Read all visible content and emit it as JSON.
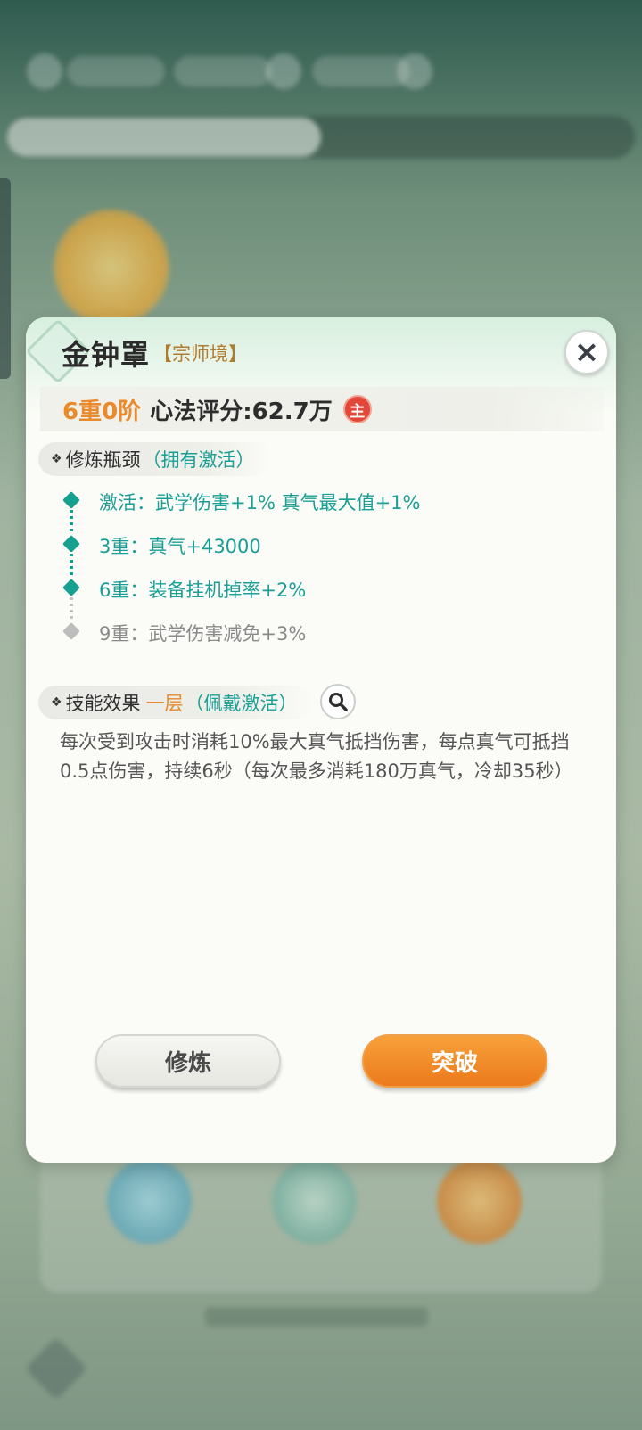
{
  "dialog": {
    "title": "金钟罩",
    "title_tag": "【宗师境】",
    "close_icon": "×",
    "rating": {
      "level": "6重0阶",
      "label": "心法评分:",
      "value": "62.7万",
      "badge": "主"
    },
    "bottleneck": {
      "icon": "❖",
      "title": "修炼瓶颈",
      "status": "（拥有激活）",
      "items": [
        {
          "text": "激活：武学伤害+1%  真气最大值+1%",
          "active": true
        },
        {
          "text": "3重：真气+43000",
          "active": true
        },
        {
          "text": "6重：装备挂机掉率+2%",
          "active": true
        },
        {
          "text": "9重：武学伤害减免+3%",
          "active": false
        }
      ]
    },
    "skill": {
      "icon": "❖",
      "title": "技能效果",
      "layer": "一层",
      "status": "（佩戴激活）",
      "zoom_icon": "magnifier-icon",
      "description": "每次受到攻击时消耗10%最大真气抵挡伤害，每点真气可抵挡0.5点伤害，持续6秒（每次最多消耗180万真气，冷却35秒）"
    },
    "buttons": {
      "train_label": "修炼",
      "breakthrough_label": "突破"
    }
  },
  "colors": {
    "accent_teal": "#1a9e95",
    "accent_orange": "#e98a2c",
    "badge_red": "#e2473a"
  }
}
